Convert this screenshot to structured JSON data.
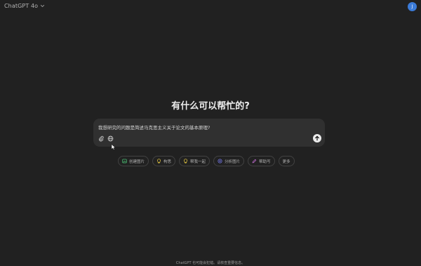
{
  "header": {
    "model_name": "ChatGPT 4o",
    "avatar_initial": "J"
  },
  "main": {
    "headline": "有什么可以帮忙的?"
  },
  "composer": {
    "input_value": "我想研究的问题是简述马克思主义关于论文的基本原理?",
    "icons": [
      "paperclip-icon",
      "globe-icon",
      "arrow-up-icon"
    ]
  },
  "chips": [
    {
      "label": "创建图片",
      "icon": "image-icon",
      "color": "#4bbf73"
    },
    {
      "label": "构思",
      "icon": "lightbulb-icon",
      "color": "#e2c541"
    },
    {
      "label": "帮我一起",
      "icon": "bulb-icon",
      "color": "#e2c541"
    },
    {
      "label": "分析图片",
      "icon": "eye-icon",
      "color": "#7c80ff"
    },
    {
      "label": "帮助写",
      "icon": "pen-icon",
      "color": "#c86fd8"
    },
    {
      "label": "更多",
      "icon": "",
      "color": ""
    }
  ],
  "footer": {
    "disclaimer": "ChatGPT 也可能会犯错。请核查重要信息。"
  },
  "colors": {
    "background": "#212121",
    "composer": "#303030",
    "avatar": "#3b7bd8"
  }
}
